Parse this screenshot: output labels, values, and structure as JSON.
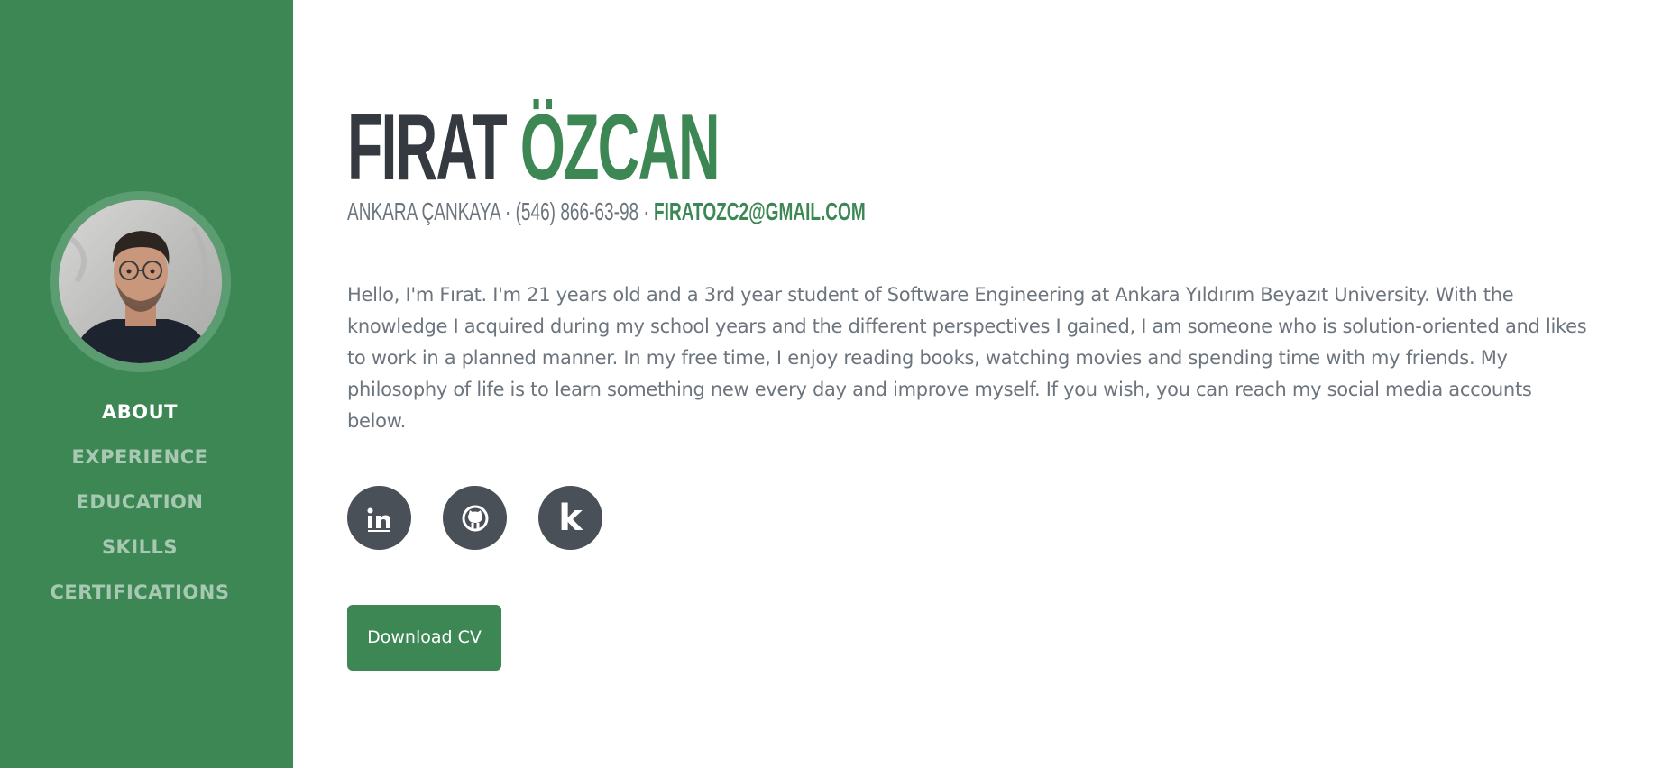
{
  "nav": {
    "items": [
      {
        "label": "ABOUT",
        "active": true
      },
      {
        "label": "EXPERIENCE",
        "active": false
      },
      {
        "label": "EDUCATION",
        "active": false
      },
      {
        "label": "SKILLS",
        "active": false
      },
      {
        "label": "CERTIFICATIONS",
        "active": false
      }
    ]
  },
  "profile": {
    "first_name": "FIRAT",
    "last_name": "ÖZCAN",
    "location_phone": "ANKARA ÇANKAYA · (546) 866-63-98 · ",
    "email": "FIRATOZC2@GMAIL.COM",
    "bio": "Hello, I'm Fırat. I'm 21 years old and a 3rd year student of Software Engineering at Ankara Yıldırım Beyazıt University. With the knowledge I acquired during my school years and the different perspectives I gained, I am someone who is solution-oriented and likes to work in a planned manner. In my free time, I enjoy reading books, watching movies and spending time with my friends. My philosophy of life is to learn something new every day and improve myself. If you wish, you can reach my social media accounts below."
  },
  "social": {
    "icons": [
      "linkedin-icon",
      "github-icon",
      "kaggle-icon"
    ],
    "kaggle_glyph": "k"
  },
  "actions": {
    "download_cv": "Download CV"
  },
  "colors": {
    "primary": "#3d8755",
    "dark": "#343a40",
    "muted": "#6c757d",
    "icon_bg": "#495057"
  }
}
